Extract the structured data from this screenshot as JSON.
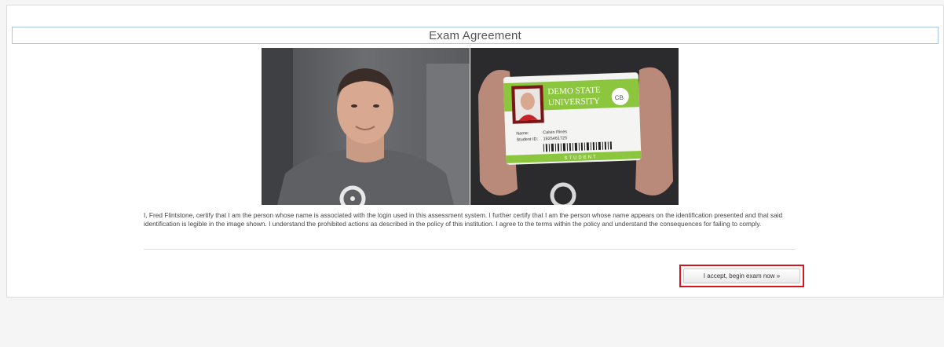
{
  "page": {
    "title": "Exam Agreement",
    "agreement_text": "I, Fred Flintstone, certify that I am the person whose name is associated with the login used in this assessment system. I further certify that I am the person whose name appears on the identification presented and that said identification is legible in the image shown. I understand the prohibited actions as described in the policy of this institution. I agree to the terms within the policy and understand the consequences for failing to comply.",
    "accept_button": "I accept, begin exam now »"
  },
  "id_card": {
    "university_line1": "DEMO STATE",
    "university_line2": "UNIVERSITY",
    "logo_text": "CB",
    "name_label": "Name:",
    "name_value": "Calvin Rines",
    "id_label": "Student ID:",
    "id_value": "1925461725",
    "footer": "STUDENT"
  },
  "colors": {
    "highlight_border": "#d9141c",
    "title_border": "#a9c5ea",
    "card_green": "#8cc63f"
  }
}
